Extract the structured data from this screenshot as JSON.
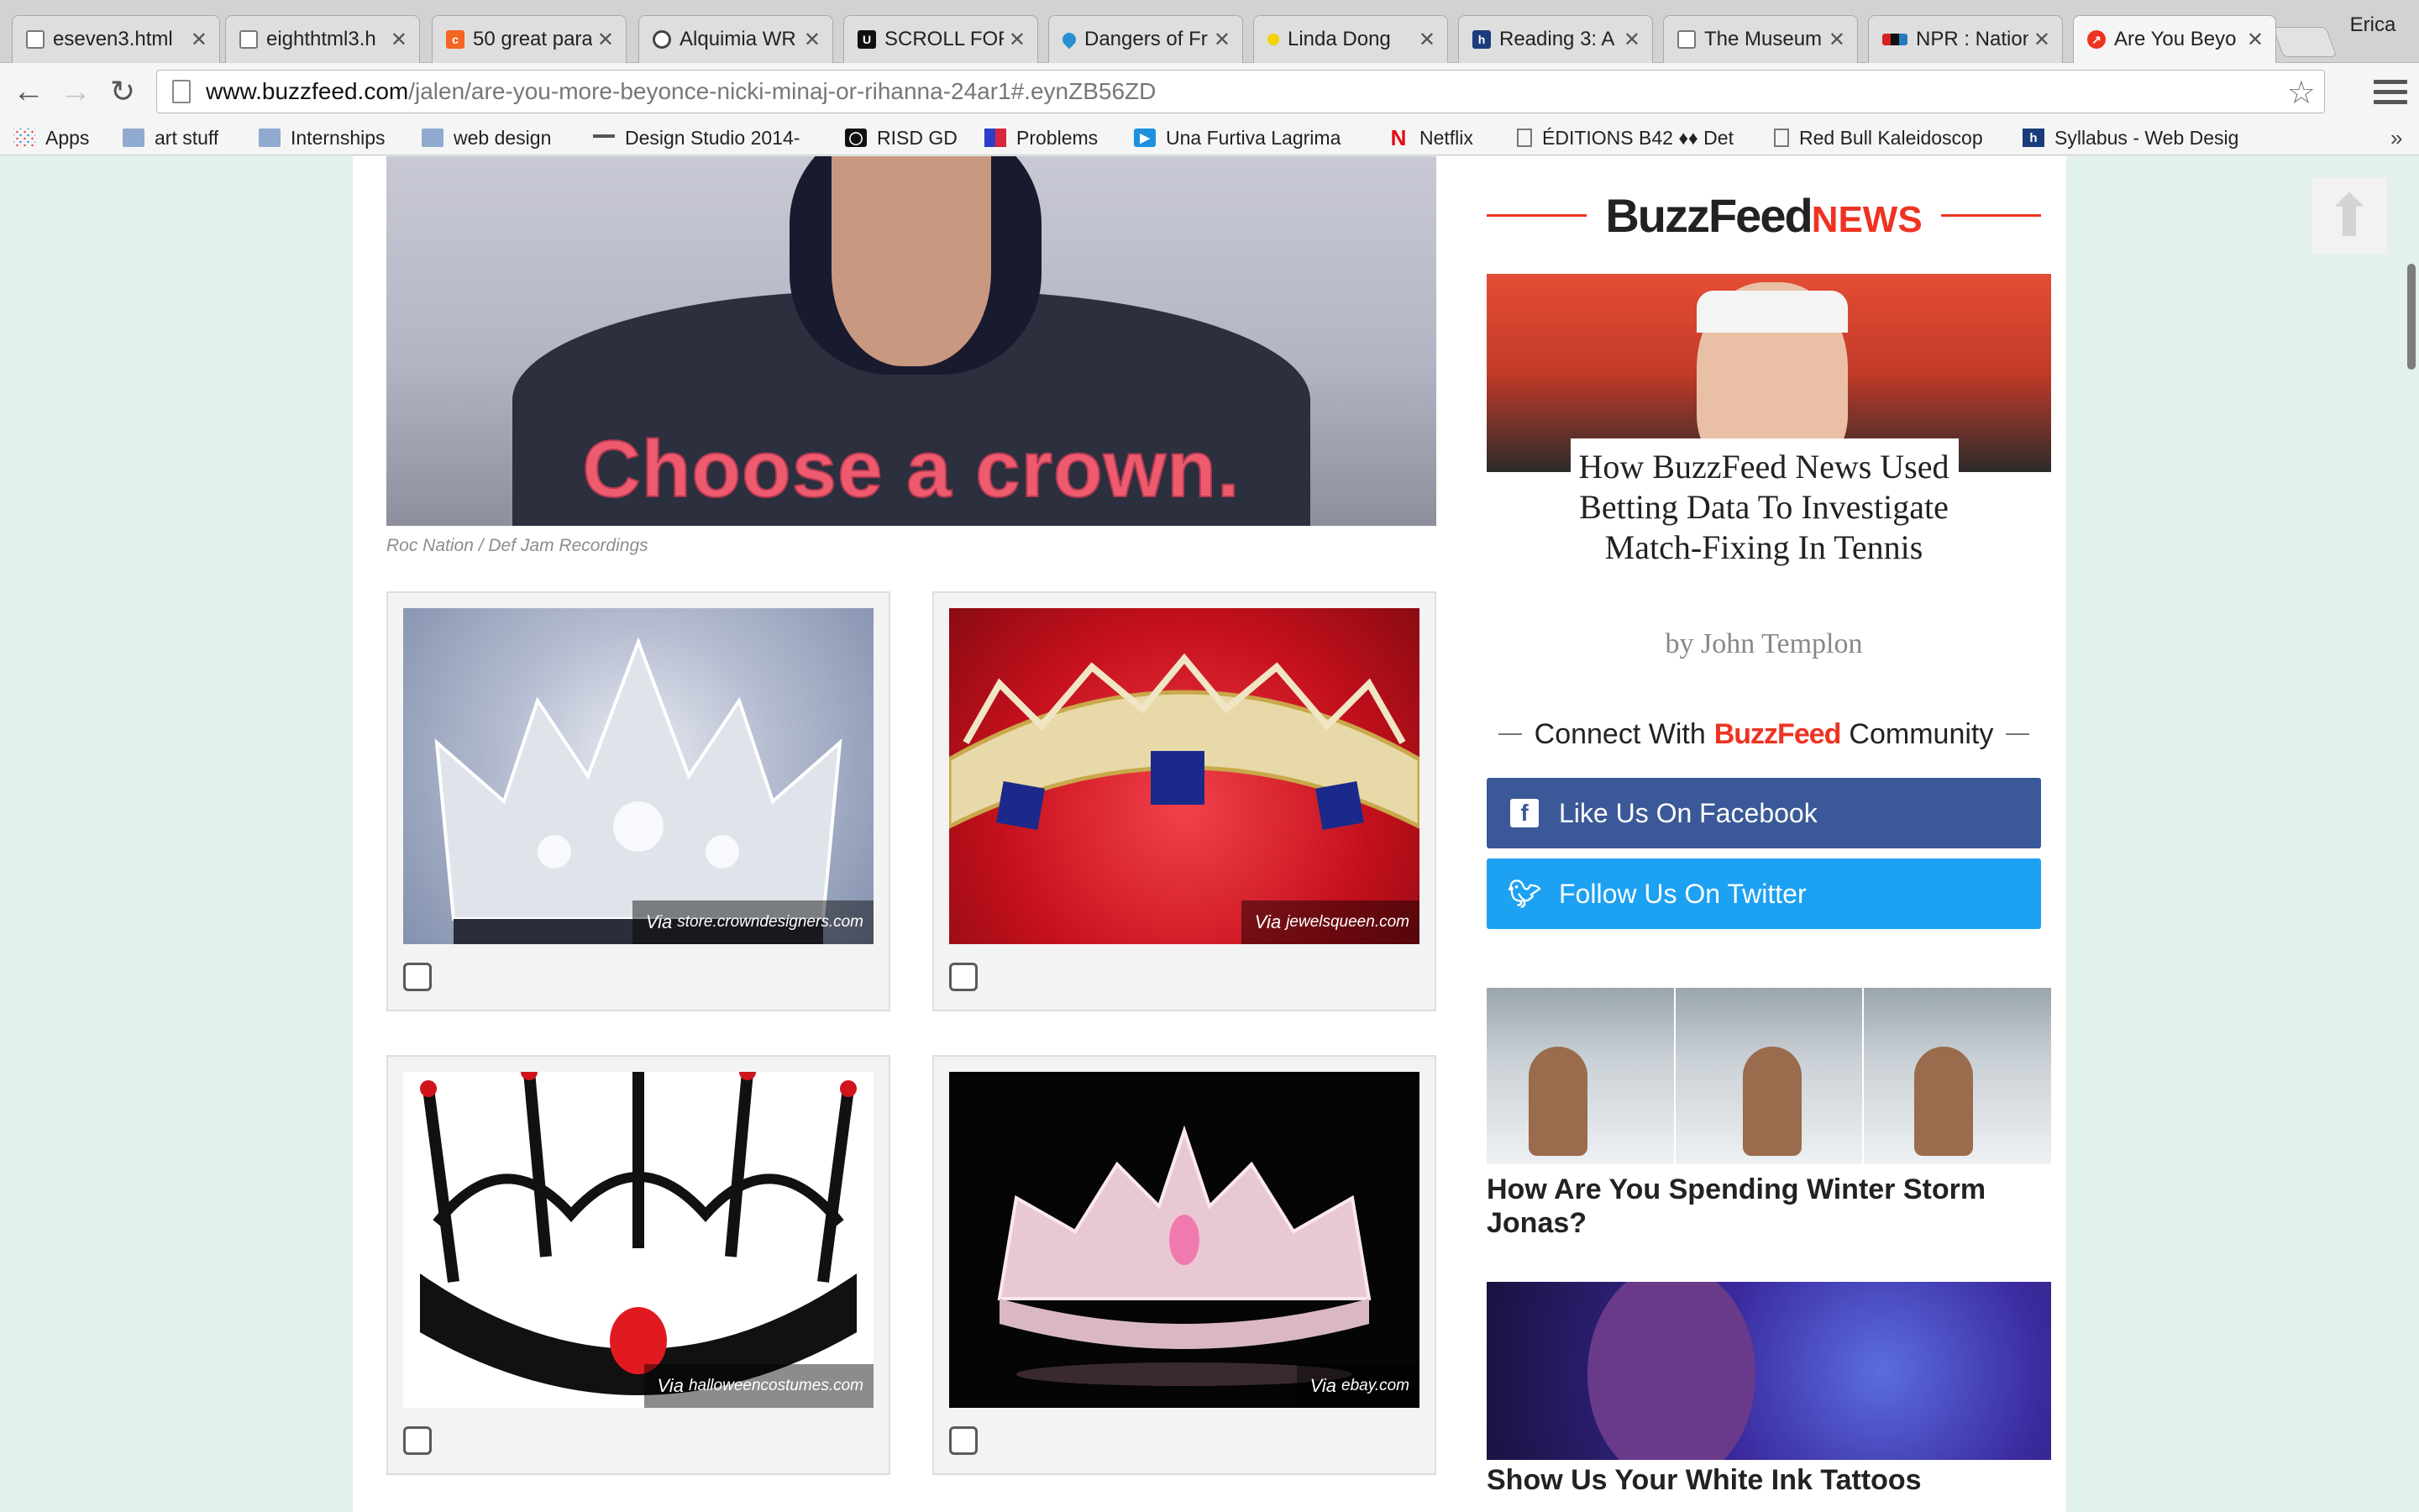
{
  "browser": {
    "tabs": [
      {
        "title": "eseven3.html",
        "icon": "document-icon"
      },
      {
        "title": "eighthtml3.h",
        "icon": "document-icon"
      },
      {
        "title": "50 great para",
        "icon": "orange-square-icon"
      },
      {
        "title": "Alquimia WR",
        "icon": "circle-logo-icon"
      },
      {
        "title": "SCROLL FOR",
        "icon": "u-logo-icon"
      },
      {
        "title": "Dangers of Fr",
        "icon": "droplet-icon"
      },
      {
        "title": "Linda Dong",
        "icon": "yellow-dot-icon"
      },
      {
        "title": "Reading 3: A",
        "icon": "h-logo-icon"
      },
      {
        "title": "The Museum",
        "icon": "document-icon"
      },
      {
        "title": "NPR : Nationa",
        "icon": "npr-icon"
      },
      {
        "title": "Are You Beyo",
        "icon": "buzzfeed-trending-icon",
        "active": true
      }
    ],
    "profile_name": "Erica",
    "url_host": "www.buzzfeed.com",
    "url_path": "/jalen/are-you-more-beyonce-nicki-minaj-or-rihanna-24ar1#.eynZB56ZD",
    "bookmarks": [
      {
        "label": "Apps",
        "icon": "apps-grid-icon"
      },
      {
        "label": "art stuff",
        "icon": "folder-icon"
      },
      {
        "label": "Internships",
        "icon": "folder-icon"
      },
      {
        "label": "web design",
        "icon": "folder-icon"
      },
      {
        "label": "Design Studio 2014-",
        "icon": "bookmark-icon"
      },
      {
        "label": "RISD GD",
        "icon": "risd-icon"
      },
      {
        "label": "Problems",
        "icon": "grid-logo-icon"
      },
      {
        "label": "Una Furtiva Lagrima",
        "icon": "play-icon"
      },
      {
        "label": "Netflix",
        "icon": "netflix-icon"
      },
      {
        "label": "ÉDITIONS B42 ♦♦ Det",
        "icon": "document-icon"
      },
      {
        "label": "Red Bull Kaleidoscop",
        "icon": "document-icon"
      },
      {
        "label": "Syllabus - Web Desig",
        "icon": "h-logo-icon"
      }
    ]
  },
  "article": {
    "hero_caption": "Choose a crown.",
    "hero_credit": "Roc Nation / Def Jam Recordings",
    "options": [
      {
        "via_prefix": "Via",
        "via_source": "store.crowndesigners.com",
        "checked": false
      },
      {
        "via_prefix": "Via",
        "via_source": "jewelsqueen.com",
        "checked": false
      },
      {
        "via_prefix": "Via",
        "via_source": "halloweencostumes.com",
        "checked": false
      },
      {
        "via_prefix": "Via",
        "via_source": "ebay.com",
        "checked": false
      }
    ]
  },
  "sidebar": {
    "news_logo_main": "BuzzFeed",
    "news_logo_sub": "NEWS",
    "feature_title": "How BuzzFeed News Used Betting Data To Investigate Match-Fixing In Tennis",
    "feature_byline": "by John Templon",
    "connect_prefix": "Connect With",
    "connect_brand": "BuzzFeed",
    "connect_suffix": "Community",
    "facebook_label": "Like Us On Facebook",
    "twitter_label": "Follow Us On Twitter",
    "post1_title": "How Are You Spending Winter Storm Jonas?",
    "post2_title": "Show Us Your White Ink Tattoos"
  },
  "colors": {
    "page_bg": "#e3f1ee",
    "buzzfeed_red": "#ee3322",
    "facebook_blue": "#3b5998",
    "twitter_blue": "#1da1f2",
    "caption_pink": "#ef5b6e"
  }
}
